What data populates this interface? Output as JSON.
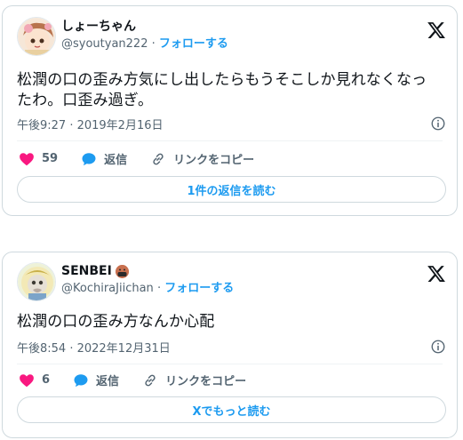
{
  "tweets": [
    {
      "user": {
        "name": "しょーちゃん",
        "handle": "@syoutyan222",
        "separator": "·",
        "follow": "フォローする"
      },
      "text": "松潤の口の歪み方気にし出したらもうそこしか見れなくなったわ。口歪み過ぎ。",
      "timestamp": "午後9:27 · 2019年2月16日",
      "likes": "59",
      "reply_label": "返信",
      "copy_link_label": "リンクをコピー",
      "button_label": "1件の返信を読む"
    },
    {
      "user": {
        "name": "SENBEI",
        "handle": "@KochiraJiichan",
        "separator": "·",
        "follow": "フォローする"
      },
      "text": "松潤の口の歪み方なんか心配",
      "timestamp": "午後8:54 · 2022年12月31日",
      "likes": "6",
      "reply_label": "返信",
      "copy_link_label": "リンクをコピー",
      "button_label": "Xでもっと読む"
    }
  ],
  "icons": {
    "logo": "x-logo-icon",
    "info": "info-icon",
    "like": "heart-icon",
    "reply": "speech-bubble-icon",
    "link": "link-icon"
  },
  "colors": {
    "accent": "#1d9bf0",
    "like": "#f91880",
    "secondary_text": "#536471",
    "border": "#cfd9de"
  }
}
